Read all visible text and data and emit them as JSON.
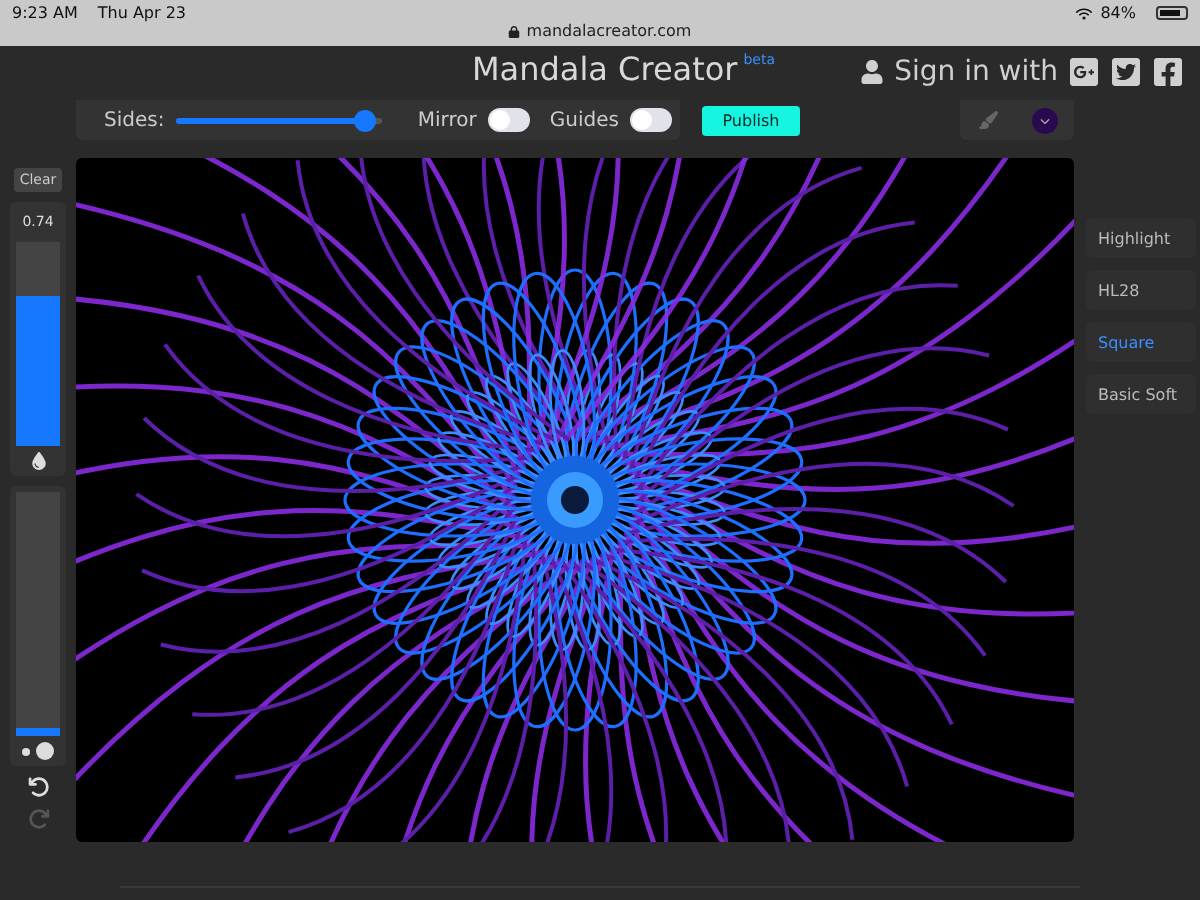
{
  "status_bar": {
    "time": "9:23 AM",
    "date": "Thu Apr 23",
    "battery": "84%"
  },
  "address_bar": {
    "url": "mandalacreator.com"
  },
  "header": {
    "title": "Mandala Creator",
    "badge": "beta",
    "sign_in": "Sign in with"
  },
  "toolbar": {
    "sides": {
      "label": "Sides:",
      "level": 0.97
    },
    "mirror": {
      "label": "Mirror",
      "on": false
    },
    "guides": {
      "label": "Guides",
      "on": false
    },
    "publish": "Publish"
  },
  "left_panel": {
    "clear": "Clear",
    "opacity": {
      "reading": "0.74",
      "level": 0.74
    },
    "size": {
      "level": 0.03
    }
  },
  "brushes": [
    {
      "label": "Highlight",
      "selected": false
    },
    {
      "label": "HL28",
      "selected": false
    },
    {
      "label": "Square",
      "selected": true
    },
    {
      "label": "Basic Soft",
      "selected": false
    }
  ]
}
